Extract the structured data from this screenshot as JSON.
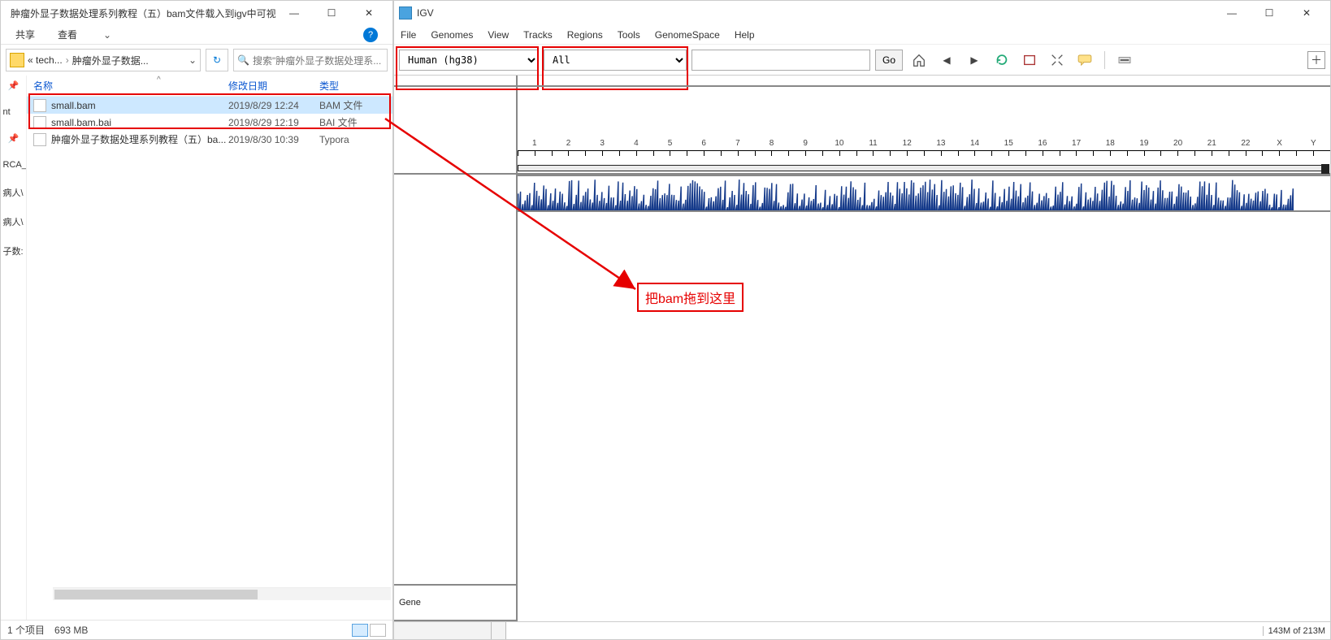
{
  "explorer": {
    "title": "肿瘤外显子数据处理系列教程（五）bam文件载入到igv中可视化",
    "ribbon": {
      "share": "共享",
      "view": "查看"
    },
    "breadcrumb": {
      "part1": "« tech...",
      "part2": "肿瘤外显子数据..."
    },
    "refresh_hint": "刷新",
    "search_placeholder": "搜索\"肿瘤外显子数据处理系...",
    "columns": {
      "name": "名称",
      "date": "修改日期",
      "type": "类型"
    },
    "files": [
      {
        "name": "small.bam",
        "date": "2019/8/29 12:24",
        "type": "BAM 文件",
        "selected": true
      },
      {
        "name": "small.bam.bai",
        "date": "2019/8/29 12:19",
        "type": "BAI 文件",
        "selected": false
      },
      {
        "name": "肿瘤外显子数据处理系列教程（五）ba...",
        "date": "2019/8/30 10:39",
        "type": "Typora",
        "selected": false
      }
    ],
    "quick": [
      "nt",
      "RCA_",
      "病人\\",
      "病人\\",
      "子数:"
    ],
    "status": {
      "left": "1 个项目",
      "right": "693 MB"
    }
  },
  "igv": {
    "title": "IGV",
    "menus": [
      "File",
      "Genomes",
      "View",
      "Tracks",
      "Regions",
      "Tools",
      "GenomeSpace",
      "Help"
    ],
    "toolbar": {
      "genome": "Human (hg38)",
      "chrom": "All",
      "go_label": "Go"
    },
    "chromosomes": [
      "1",
      "2",
      "3",
      "4",
      "5",
      "6",
      "7",
      "8",
      "9",
      "10",
      "11",
      "12",
      "13",
      "14",
      "15",
      "16",
      "17",
      "18",
      "19",
      "20",
      "21",
      "22",
      "X",
      "Y"
    ],
    "gene_label": "Gene",
    "memory": "143M of 213M"
  },
  "annotation": {
    "drag_hint": "把bam拖到这里"
  }
}
